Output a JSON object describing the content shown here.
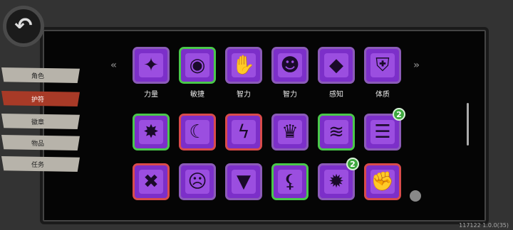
{
  "back_icon": "back-arrow-icon",
  "sidebar": {
    "items": [
      {
        "label": "角色",
        "active": false
      },
      {
        "label": "护符",
        "active": true
      },
      {
        "label": "徽章",
        "active": false
      },
      {
        "label": "物品",
        "active": false
      },
      {
        "label": "任务",
        "active": false
      }
    ]
  },
  "equipped": [
    {
      "label": "力量",
      "border": "purple",
      "icon": "claw-crystal-icon"
    },
    {
      "label": "敏捷",
      "border": "green",
      "icon": "disc-icon"
    },
    {
      "label": "智力",
      "border": "purple",
      "icon": "handshake-icon"
    },
    {
      "label": "智力",
      "border": "purple",
      "icon": "mask-face-icon"
    },
    {
      "label": "感知",
      "border": "purple",
      "icon": "gem-pendant-icon"
    },
    {
      "label": "体质",
      "border": "purple",
      "icon": "shield-icon"
    }
  ],
  "row2": [
    {
      "border": "green",
      "icon": "shatter-icon",
      "badge": ""
    },
    {
      "border": "red",
      "icon": "crescent-icon",
      "badge": ""
    },
    {
      "border": "red",
      "icon": "lightning-icon",
      "badge": ""
    },
    {
      "border": "purple",
      "icon": "spike-crown-icon",
      "badge": ""
    },
    {
      "border": "green",
      "icon": "cracks-icon",
      "badge": ""
    },
    {
      "border": "purple",
      "icon": "stairs-icon",
      "badge": "2"
    }
  ],
  "row3": [
    {
      "border": "red",
      "icon": "bones-icon",
      "badge": ""
    },
    {
      "border": "purple",
      "icon": "ghost-face-icon",
      "badge": ""
    },
    {
      "border": "purple",
      "icon": "warning-triangles-icon",
      "badge": ""
    },
    {
      "border": "green",
      "icon": "claw-marks-icon",
      "badge": ""
    },
    {
      "border": "purple",
      "icon": "spiky-creature-icon",
      "badge": "2"
    },
    {
      "border": "red",
      "icon": "fist-icon",
      "badge": ""
    }
  ],
  "version": "117122 1.0.0(35)",
  "colors": {
    "accent_active": "#a83a27",
    "green_border": "#4ac84a",
    "red_border": "#d94b4b",
    "purple": "#7c2fc9"
  }
}
